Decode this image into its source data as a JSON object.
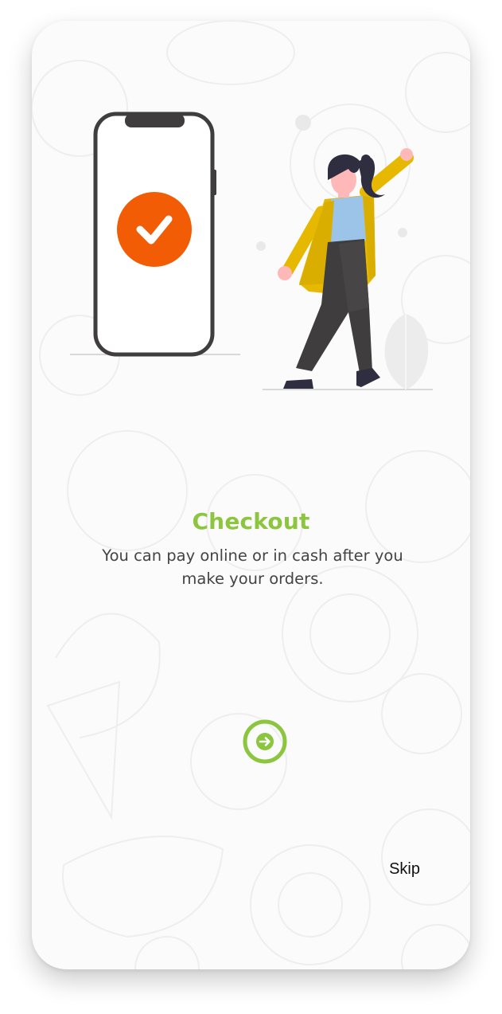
{
  "onboarding": {
    "title": "Checkout",
    "description": "You can pay online or in cash after you make your orders.",
    "skip_label": "Skip",
    "next_icon": "arrow-right-circle-icon",
    "illustration": "phone-checkmark-woman-celebrating"
  },
  "colors": {
    "accent": "#8cc63f",
    "check_badge": "#f25c05",
    "jacket": "#e6b800",
    "text": "#444444"
  }
}
